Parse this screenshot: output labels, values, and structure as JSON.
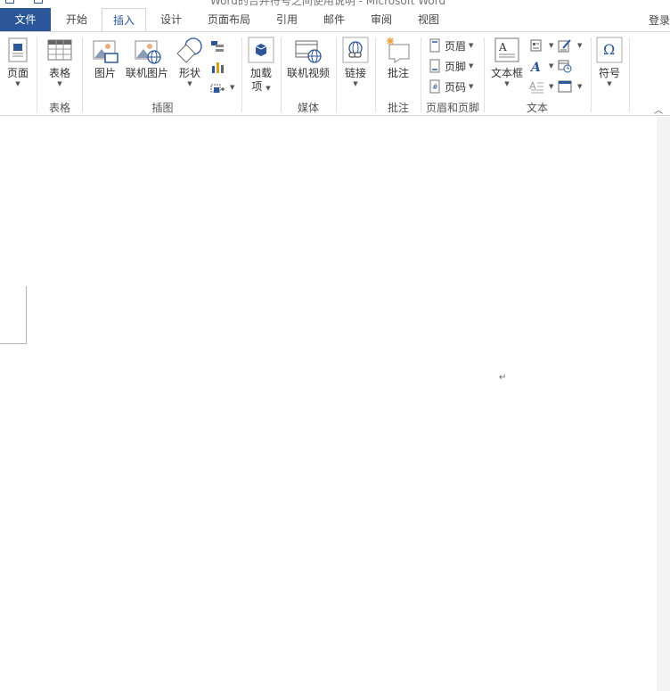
{
  "window": {
    "title": "Word的合并符号之间使用说明 - Microsoft Word"
  },
  "tabs": [
    {
      "id": "file",
      "label": "文件"
    },
    {
      "id": "home",
      "label": "开始"
    },
    {
      "id": "insert",
      "label": "插入"
    },
    {
      "id": "design",
      "label": "设计"
    },
    {
      "id": "layout",
      "label": "页面布局"
    },
    {
      "id": "references",
      "label": "引用"
    },
    {
      "id": "mailings",
      "label": "邮件"
    },
    {
      "id": "review",
      "label": "审阅"
    },
    {
      "id": "view",
      "label": "视图"
    }
  ],
  "active_tab": "插入",
  "login_label": "登录",
  "ribbon": {
    "pages": {
      "button": "页面",
      "group": ""
    },
    "tables": {
      "button": "表格",
      "group": "表格"
    },
    "illustrations": {
      "picture": "图片",
      "online_picture": "联机图片",
      "shapes": "形状",
      "group": "插图"
    },
    "addins": {
      "button_line1": "加载",
      "button_line2": "项"
    },
    "media": {
      "online_video": "联机视频",
      "group": "媒体"
    },
    "links": {
      "button": "链接"
    },
    "comments": {
      "button": "批注",
      "group": "批注"
    },
    "header_footer": {
      "header": "页眉",
      "footer": "页脚",
      "page_number": "页码",
      "group": "页眉和页脚"
    },
    "text": {
      "textbox": "文本框",
      "group": "文本"
    },
    "symbols": {
      "button": "符号"
    }
  },
  "document": {
    "paragraph_mark": "↵"
  },
  "colors": {
    "accent": "#2b579a",
    "icon_blue": "#2b579a",
    "icon_orange": "#d24726"
  }
}
